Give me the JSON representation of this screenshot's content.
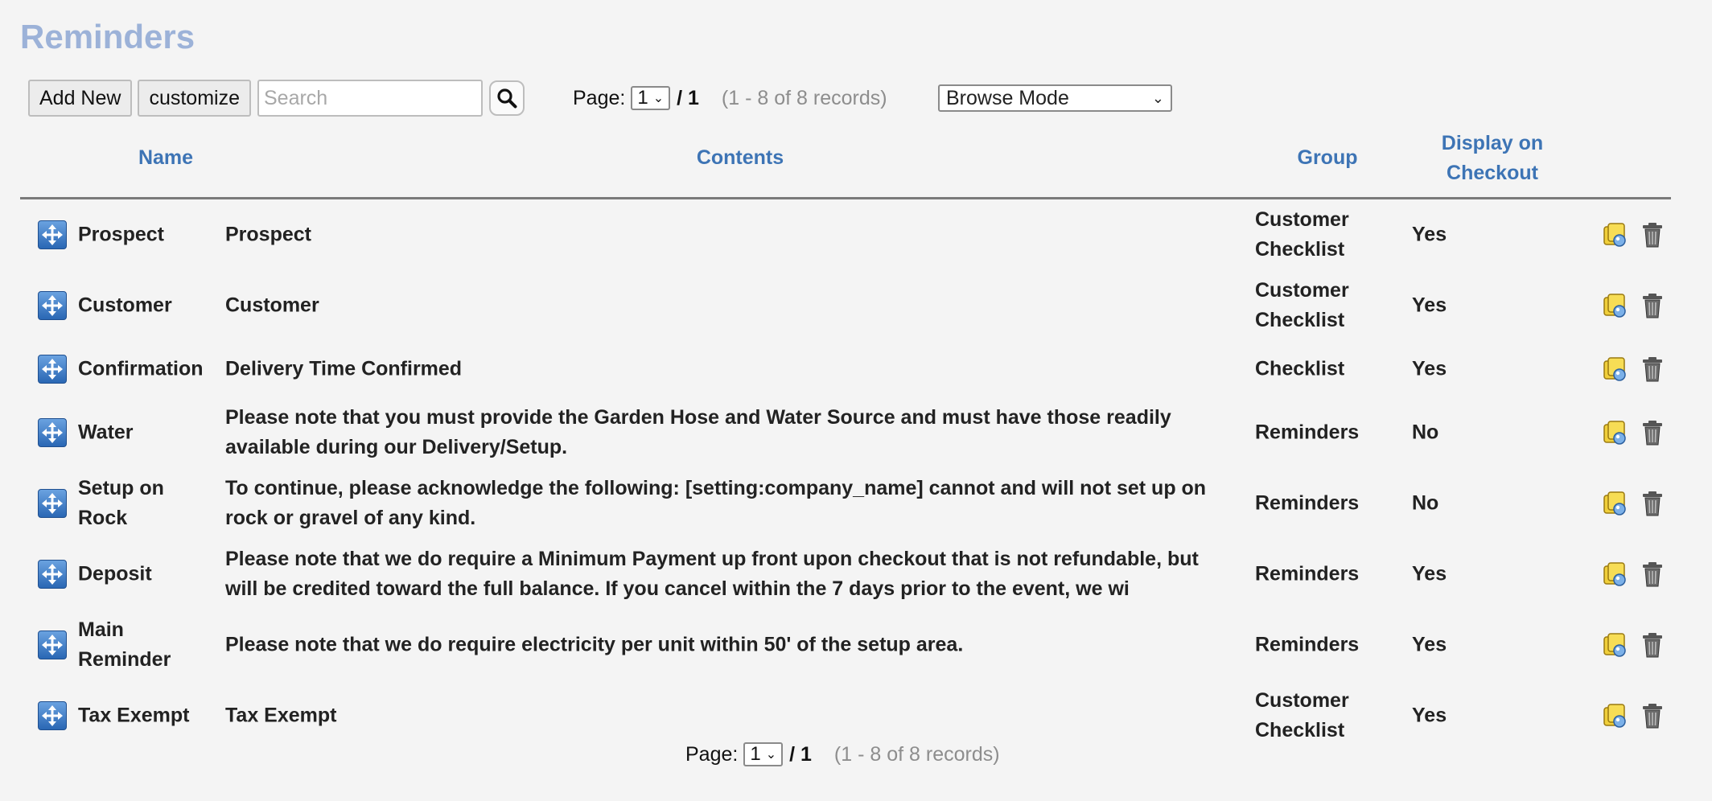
{
  "page": {
    "title": "Reminders"
  },
  "toolbar": {
    "add_new_label": "Add New",
    "customize_label": "customize",
    "search_placeholder": "Search",
    "search_icon": "search-icon"
  },
  "pager": {
    "label": "Page:",
    "current": "1",
    "separator": "/",
    "total": "1",
    "records": "(1 - 8 of 8 records)"
  },
  "mode": {
    "selected": "Browse Mode"
  },
  "table": {
    "columns": {
      "name": "Name",
      "contents": "Contents",
      "group": "Group",
      "display_line1": "Display on",
      "display_line2": "Checkout"
    },
    "rows": [
      {
        "name": "Prospect",
        "contents": "Prospect",
        "group": "Customer Checklist",
        "display": "Yes"
      },
      {
        "name": "Customer",
        "contents": "Customer",
        "group": "Customer Checklist",
        "display": "Yes"
      },
      {
        "name": "Confirmation",
        "contents": "Delivery Time Confirmed",
        "group": "Checklist",
        "display": "Yes"
      },
      {
        "name": "Water",
        "contents": "Please note that you must provide the Garden Hose and Water Source and must have those readily available during our Delivery/Setup.",
        "group": "Reminders",
        "display": "No"
      },
      {
        "name": "Setup on Rock",
        "contents": "To continue, please acknowledge the following: [setting:company_name] cannot and will not set up on rock or gravel of any kind.",
        "group": "Reminders",
        "display": "No"
      },
      {
        "name": "Deposit",
        "contents": "Please note that we do require a Minimum Payment up front upon checkout that is not refundable, but will be credited toward the full balance. If you cancel within the 7 days prior to the event, we wi",
        "group": "Reminders",
        "display": "Yes"
      },
      {
        "name": "Main Reminder",
        "contents": "Please note that we do require electricity per unit within 50' of the setup area.",
        "group": "Reminders",
        "display": "Yes"
      },
      {
        "name": "Tax Exempt",
        "contents": "Tax Exempt",
        "group": "Customer Checklist",
        "display": "Yes"
      }
    ]
  },
  "icons": {
    "move": "move-icon",
    "edit": "edit-icon",
    "delete": "trash-icon"
  }
}
